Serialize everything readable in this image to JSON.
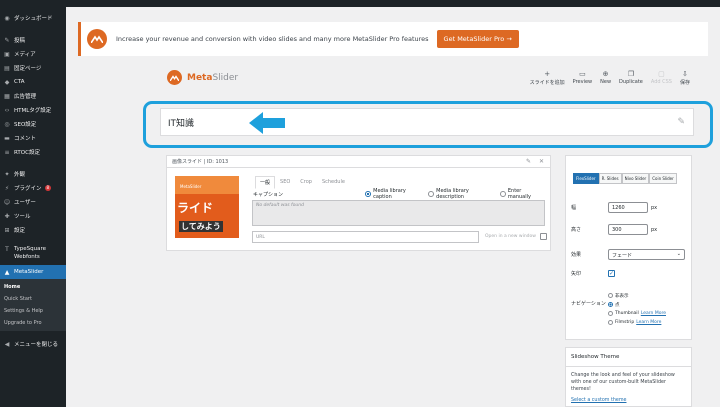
{
  "sidebar": {
    "items": [
      {
        "icon": "dashboard-icon",
        "glyph": "◉",
        "label": "ダッシュボード"
      },
      {
        "icon": "pin-icon",
        "glyph": "✎",
        "label": "投稿"
      },
      {
        "icon": "media-icon",
        "glyph": "▣",
        "label": "メディア"
      },
      {
        "icon": "page-icon",
        "glyph": "▤",
        "label": "固定ページ"
      },
      {
        "icon": "cta-icon",
        "glyph": "◆",
        "label": "CTA"
      },
      {
        "icon": "ad-icon",
        "glyph": "▦",
        "label": "広告管理"
      },
      {
        "icon": "code-icon",
        "glyph": "‹›",
        "label": "HTMLタグ設定"
      },
      {
        "icon": "seo-icon",
        "glyph": "◎",
        "label": "SEO設定"
      },
      {
        "icon": "comment-icon",
        "glyph": "▬",
        "label": "コメント"
      },
      {
        "icon": "rtoc-icon",
        "glyph": "≡",
        "label": "RTOC設定"
      }
    ],
    "items2": [
      {
        "icon": "appearance-icon",
        "glyph": "✦",
        "label": "外観"
      },
      {
        "icon": "plugin-icon",
        "glyph": "⚡",
        "label": "プラグイン",
        "badge": "8"
      },
      {
        "icon": "user-icon",
        "glyph": "👤",
        "label": "ユーザー"
      },
      {
        "icon": "tools-icon",
        "glyph": "✚",
        "label": "ツール"
      },
      {
        "icon": "settings-icon",
        "glyph": "⊞",
        "label": "設定"
      }
    ],
    "typesquare_label": "TypeSquare",
    "typesquare_sub": "Webfonts",
    "metaslider_label": "MetaSlider",
    "submenu": [
      "Home",
      "Quick Start",
      "Settings & Help",
      "Upgrade to Pro"
    ],
    "collapse_label": "メニューを閉じる"
  },
  "banner": {
    "text": "Increase your revenue and conversion with video slides and many more MetaSlider Pro features",
    "button": "Get MetaSlider Pro →"
  },
  "header": {
    "brand": "Meta",
    "brand2": "Slider",
    "tools": [
      {
        "icon": "plus-icon",
        "glyph": "+",
        "label": "スライドを追加",
        "disabled": false
      },
      {
        "icon": "preview-icon",
        "glyph": "▭",
        "label": "Preview",
        "disabled": false
      },
      {
        "icon": "new-icon",
        "glyph": "⊕",
        "label": "New",
        "disabled": false
      },
      {
        "icon": "duplicate-icon",
        "glyph": "❐",
        "label": "Duplicate",
        "disabled": false
      },
      {
        "icon": "css-icon",
        "glyph": "▢",
        "label": "Add CSS",
        "disabled": true
      },
      {
        "icon": "save-icon",
        "glyph": "⇩",
        "label": "保存",
        "disabled": false
      }
    ]
  },
  "title_field": {
    "value": "IT知識"
  },
  "slide": {
    "header": "画像スライド | ID: 1013",
    "thumb_label": "MetaSlider",
    "thumb_big": "ライド",
    "thumb_small": "してみよう",
    "tabs": [
      "一般",
      "SEO",
      "Crop",
      "Schedule"
    ],
    "caption_label": "キャプション",
    "caption_options": [
      "Media library caption",
      "Media library description",
      "Enter manually"
    ],
    "caption_placeholder": "No default was found",
    "url_placeholder": "URL",
    "new_window_label": "Open in a new window"
  },
  "settings": {
    "types": [
      "FlexSlider",
      "R. Slides",
      "Nivo Slider",
      "Coin Slider"
    ],
    "width_label": "幅",
    "width_value": "1260",
    "height_label": "高さ",
    "height_value": "300",
    "unit": "px",
    "effect_label": "効果",
    "effect_value": "フェード",
    "arrows_label": "矢印",
    "nav_label": "ナビゲーション",
    "nav_options": [
      {
        "label": "非表示",
        "on": false,
        "link": ""
      },
      {
        "label": "点",
        "on": true,
        "link": ""
      },
      {
        "label": "Thumbnail",
        "on": false,
        "link": "Learn More"
      },
      {
        "label": "Filmstrip",
        "on": false,
        "link": "Learn More"
      }
    ]
  },
  "theme": {
    "title": "Slideshow Theme",
    "desc": "Change the look and feel of your slideshow with one of our custom-built MetaSlider themes!",
    "link": "Select a custom theme"
  },
  "colors": {
    "accent": "#dd6923",
    "highlight": "#1ea0dc",
    "wp_blue": "#2271b1"
  }
}
